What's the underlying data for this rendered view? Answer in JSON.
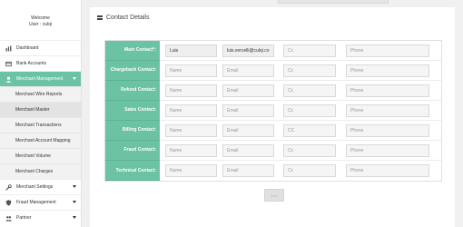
{
  "sidebar": {
    "welcome_line1": "Welcome",
    "welcome_line2": "User : culqi",
    "items": [
      {
        "label": "Dashboard",
        "icon": "chart-icon"
      },
      {
        "label": "Bank Accounts",
        "icon": "bank-card-icon"
      },
      {
        "label": "Merchant Management",
        "icon": "user-icon",
        "active": true
      },
      {
        "label": "Merchant Settings",
        "icon": "wrench-icon"
      },
      {
        "label": "Fraud Management",
        "icon": "shield-icon"
      },
      {
        "label": "Partner",
        "icon": "users-icon"
      }
    ],
    "subitems": [
      "Merchant Wire Reports",
      "Merchant Master",
      "Merchant Transactions",
      "Merchant Account Mapping",
      "Merchant Volume",
      "Merchant Charges"
    ],
    "selected_subitem": "Merchant Master"
  },
  "panel": {
    "title": "Contact Details",
    "rows": [
      {
        "label": "Main Contact*:",
        "name": "Luis",
        "email": "luis.vercelli@culqi.co",
        "cc": "Cc",
        "phone": "Phone"
      },
      {
        "label": "Chargeback Contact:",
        "name": "Name",
        "email": "Email",
        "cc": "Cc",
        "phone": "Phone"
      },
      {
        "label": "Refund Contact:",
        "name": "Name",
        "email": "Email",
        "cc": "Cc",
        "phone": "Phone"
      },
      {
        "label": "Sales Contact:",
        "name": "Name",
        "email": "Email",
        "cc": "Cc",
        "phone": "Phone"
      },
      {
        "label": "Billing Contact:",
        "name": "Name",
        "email": "Email",
        "cc": "CC",
        "phone": "Phone"
      },
      {
        "label": "Fraud Contact:",
        "name": "Name",
        "email": "Email",
        "cc": "Cc",
        "phone": "Phone"
      },
      {
        "label": "Technical Contact:",
        "name": "Name",
        "email": "Email",
        "cc": "Cc",
        "phone": "Phone"
      }
    ],
    "submit_label": "Save"
  },
  "colors": {
    "accent": "#6cc3a4",
    "sidebar_bg": "#ffffff",
    "page_bg": "#f0f0f0"
  }
}
